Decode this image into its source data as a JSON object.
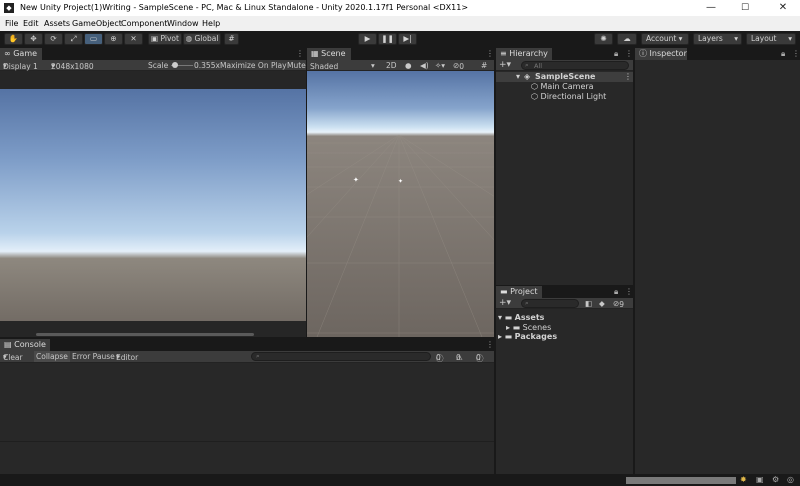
{
  "window": {
    "title": "New Unity Project(1)Writing - SampleScene - PC, Mac & Linux Standalone - Unity 2020.1.17f1 Personal <DX11>",
    "minimize": "—",
    "maximize": "☐",
    "close": "✕"
  },
  "menu": [
    "File",
    "Edit",
    "Assets",
    "GameObject",
    "Component",
    "Window",
    "Help"
  ],
  "toolbar": {
    "pivot": "Pivot",
    "global": "Global",
    "account": "Account",
    "layers": "Layers",
    "layout": "Layout"
  },
  "game": {
    "tab": "Game",
    "display": "Display 1",
    "resolution": "2048x1080",
    "scale_label": "Scale",
    "scale_value": "0.355x",
    "maximize": "Maximize On Play",
    "mute": "Mute"
  },
  "scene": {
    "tab": "Scene",
    "shading": "Shaded",
    "mode2d": "2D",
    "hidden_count": "0"
  },
  "hierarchy": {
    "tab": "Hierarchy",
    "search_placeholder": "All",
    "scene": "SampleScene",
    "items": [
      "Main Camera",
      "Directional Light"
    ]
  },
  "inspector": {
    "tab": "Inspector"
  },
  "project": {
    "tab": "Project",
    "hidden_count": "9",
    "assets": "Assets",
    "scenes": "Scenes",
    "packages": "Packages"
  },
  "console": {
    "tab": "Console",
    "clear": "Clear",
    "collapse": "Collapse",
    "error_pause": "Error Pause",
    "editor": "Editor",
    "info_count": "0",
    "warn_count": "0",
    "error_count": "0"
  }
}
